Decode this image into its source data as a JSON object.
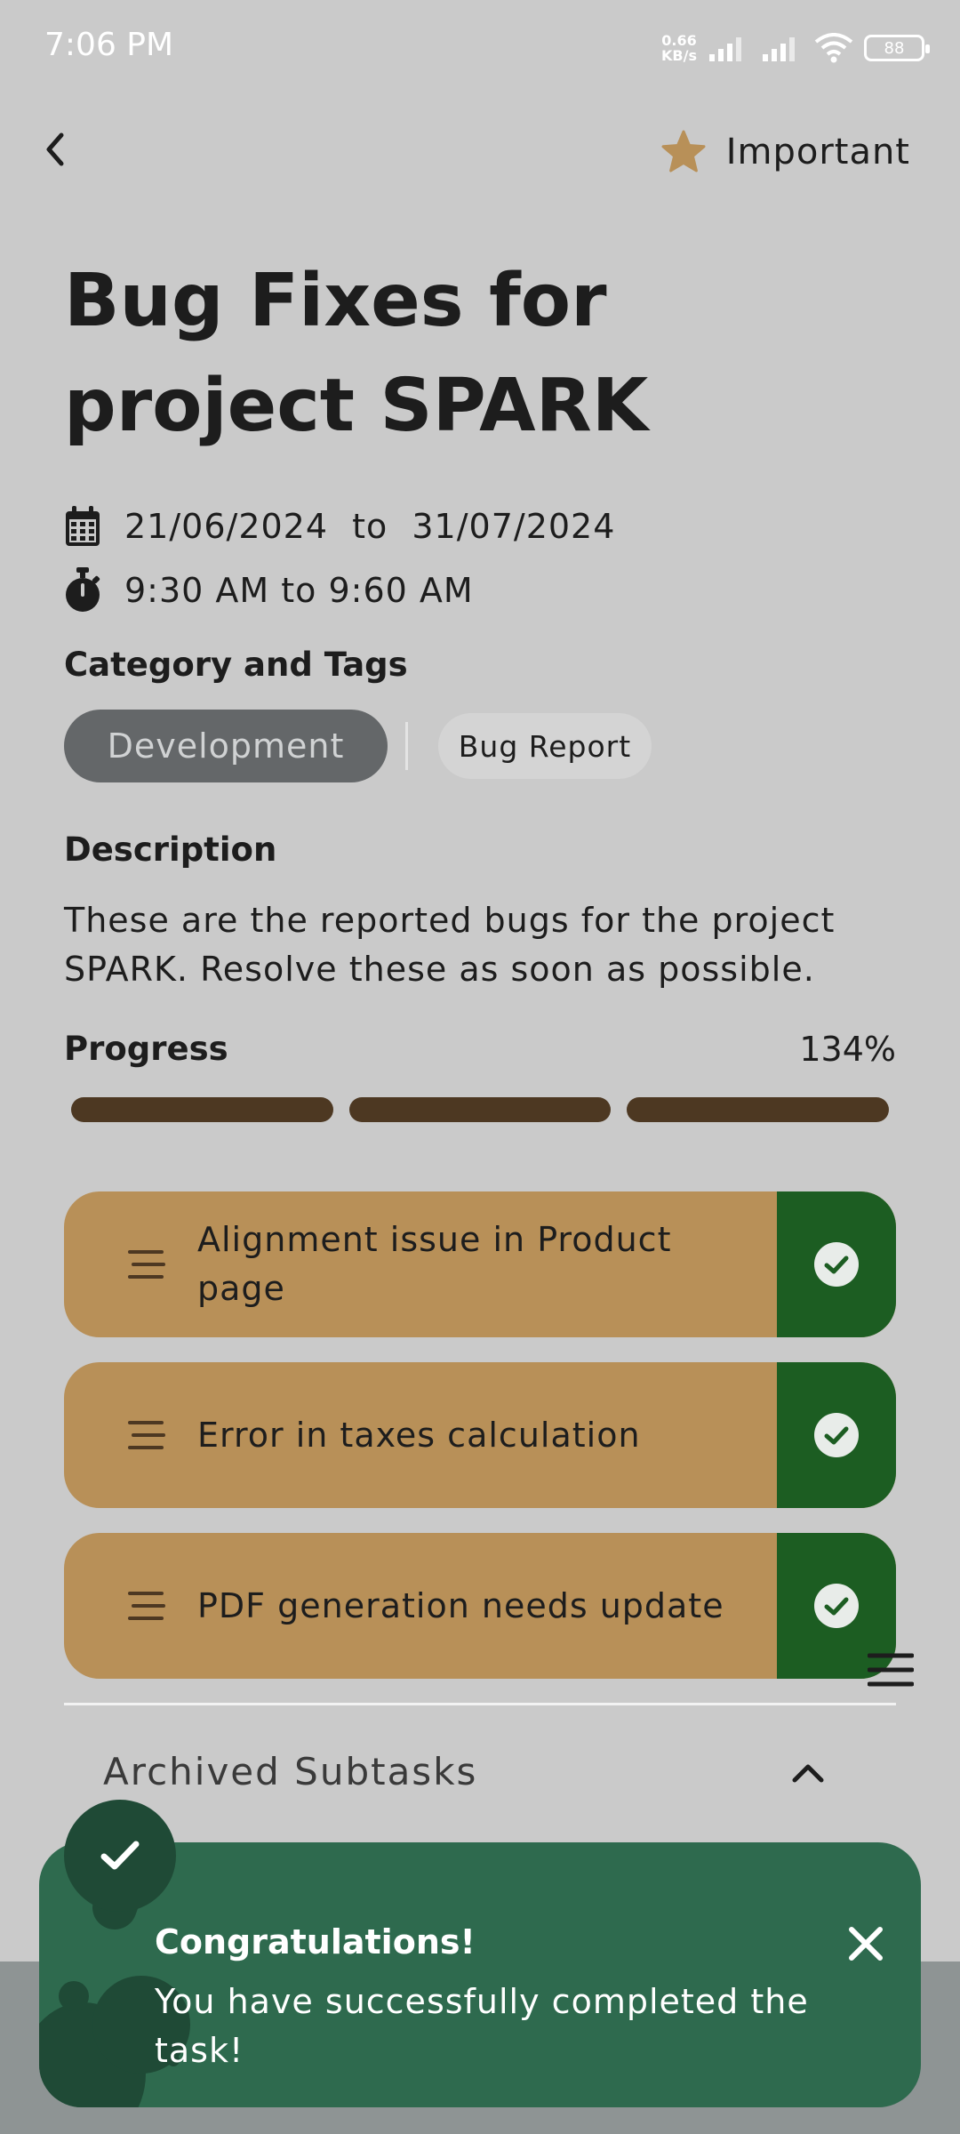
{
  "status_bar": {
    "time": "7:06 PM",
    "net_speed_value": "0.66",
    "net_speed_unit": "KB/s",
    "battery": "88"
  },
  "header": {
    "important_label": "Important",
    "back_icon": "chevron-left-icon",
    "important_icon": "star-icon"
  },
  "task": {
    "title": "Bug Fixes for project SPARK",
    "start_date": "21/06/2024",
    "date_separator": "to",
    "end_date": "31/07/2024",
    "time_range": "9:30 AM to 9:60 AM"
  },
  "category": {
    "label": "Category and Tags",
    "primary_tag": "Development",
    "secondary_tag": "Bug Report"
  },
  "description": {
    "label": "Description",
    "text": "These are the reported bugs for the project SPARK. Resolve these as soon as possible."
  },
  "progress": {
    "label": "Progress",
    "value_text": "134%",
    "segments_filled": 3,
    "segments_total": 3
  },
  "subtasks": [
    {
      "title": "Alignment issue in Product page",
      "completed": true
    },
    {
      "title": "Error in taxes calculation",
      "completed": true
    },
    {
      "title": "PDF generation needs update",
      "completed": true
    }
  ],
  "archived": {
    "label": "Archived Subtasks"
  },
  "toast": {
    "title": "Congratulations!",
    "message": "You have successfully completed the task!"
  },
  "colors": {
    "background": "#cacaca",
    "accent_gold": "#b89058",
    "done_green": "#1c5d22",
    "progress_brown": "#4d3822",
    "toast_green": "#2e6a4e",
    "tag_grey": "#646769"
  }
}
